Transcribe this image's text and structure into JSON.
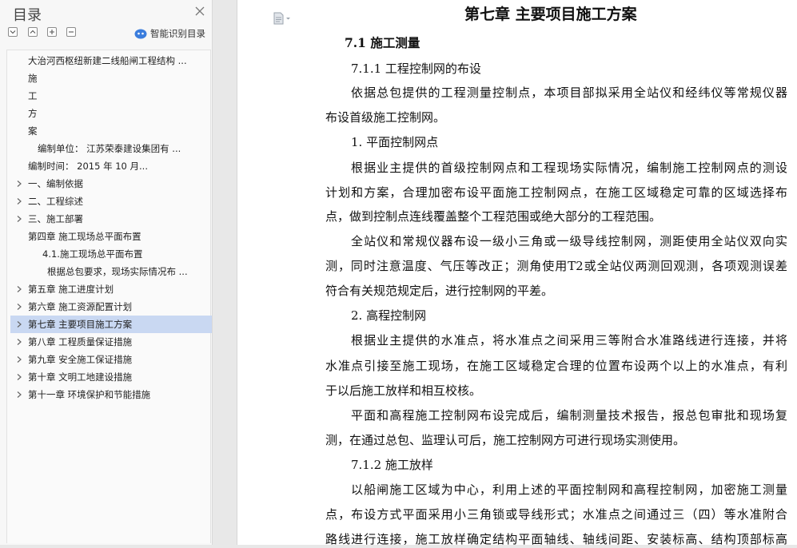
{
  "sidebar": {
    "title": "目录",
    "smart_toc_label": "智能识别目录",
    "items": [
      {
        "label": "大治河西枢纽新建二线船闸工程结构 ...",
        "level": 2,
        "arrow": false,
        "selected": false
      },
      {
        "label": "施",
        "level": 2,
        "arrow": false,
        "selected": false
      },
      {
        "label": "工",
        "level": 2,
        "arrow": false,
        "selected": false
      },
      {
        "label": "方",
        "level": 2,
        "arrow": false,
        "selected": false
      },
      {
        "label": "案",
        "level": 2,
        "arrow": false,
        "selected": false
      },
      {
        "label": "编制单位：    江苏荣泰建设集团有 ...",
        "level": 3,
        "arrow": false,
        "selected": false
      },
      {
        "label": "编制时间：    2015    年    10    月...",
        "level": 2,
        "arrow": false,
        "selected": false
      },
      {
        "label": "一、编制依据",
        "level": 1,
        "arrow": true,
        "selected": false
      },
      {
        "label": "二、工程综述",
        "level": 1,
        "arrow": true,
        "selected": false
      },
      {
        "label": "三、施工部署",
        "level": 1,
        "arrow": true,
        "selected": false
      },
      {
        "label": "第四章  施工现场总平面布置",
        "level": 1,
        "arrow": false,
        "selected": false
      },
      {
        "label": "4.1.施工现场总平面布置",
        "level": 4,
        "arrow": false,
        "selected": false
      },
      {
        "label": "根据总包要求，现场实际情况布 ...",
        "level": 5,
        "arrow": false,
        "selected": false
      },
      {
        "label": "第五章  施工进度计划",
        "level": 1,
        "arrow": true,
        "selected": false
      },
      {
        "label": "第六章  施工资源配置计划",
        "level": 1,
        "arrow": true,
        "selected": false
      },
      {
        "label": "第七章  主要项目施工方案",
        "level": 1,
        "arrow": true,
        "selected": true
      },
      {
        "label": "第八章  工程质量保证措施",
        "level": 1,
        "arrow": true,
        "selected": false
      },
      {
        "label": "第九章    安全施工保证措施",
        "level": 1,
        "arrow": true,
        "selected": false
      },
      {
        "label": "第十章    文明工地建设措施",
        "level": 1,
        "arrow": true,
        "selected": false
      },
      {
        "label": "第十一章  环境保护和节能措施",
        "level": 1,
        "arrow": true,
        "selected": false
      }
    ]
  },
  "document": {
    "chapter_title": "第七章  主要项目施工方案",
    "lines": [
      {
        "text": "7.1 施工测量",
        "kind": "sec",
        "indent": 24,
        "justify": false
      },
      {
        "text": "7.1.1 工程控制网的布设",
        "kind": "normal",
        "indent": 32,
        "justify": false
      },
      {
        "text": "依据总包提供的工程测量控制点，本项目部拟采用全站仪和经纬仪等常规仪器",
        "kind": "normal",
        "indent": 32,
        "justify": true
      },
      {
        "text": "布设首级施工控制网。",
        "kind": "normal",
        "indent": 0,
        "justify": false
      },
      {
        "text": "1. 平面控制网点",
        "kind": "normal",
        "indent": 32,
        "justify": false
      },
      {
        "text": "根据业主提供的首级控制网点和工程现场实际情况，编制施工控制网点的测设",
        "kind": "normal",
        "indent": 32,
        "justify": true
      },
      {
        "text": "计划和方案，合理加密布设平面施工控制网点，在施工区域稳定可靠的区域选择布",
        "kind": "normal",
        "indent": 0,
        "justify": true
      },
      {
        "text": "点，做到控制点连线覆盖整个工程范围或绝大部分的工程范围。",
        "kind": "normal",
        "indent": 0,
        "justify": false
      },
      {
        "text": "全站仪和常规仪器布设一级小三角或一级导线控制网，测距使用全站仪双向实",
        "kind": "normal",
        "indent": 32,
        "justify": true
      },
      {
        "text": "测，同时注意温度、气压等改正；测角使用T2或全站仪两测回观测，各项观测误差",
        "kind": "normal",
        "indent": 0,
        "justify": true
      },
      {
        "text": "符合有关规范规定后，进行控制网的平差。",
        "kind": "normal",
        "indent": 0,
        "justify": false
      },
      {
        "text": "2. 高程控制网",
        "kind": "normal",
        "indent": 32,
        "justify": false
      },
      {
        "text": "根据业主提供的水准点，将水准点之间采用三等附合水准路线进行连接，并将",
        "kind": "normal",
        "indent": 32,
        "justify": true
      },
      {
        "text": "水准点引接至施工现场，在施工区域稳定合理的位置布设两个以上的水准点，有利",
        "kind": "normal",
        "indent": 0,
        "justify": true
      },
      {
        "text": "于以后施工放样和相互校核。",
        "kind": "normal",
        "indent": 0,
        "justify": false
      },
      {
        "text": "平面和高程施工控制网布设完成后，编制测量技术报告，报总包审批和现场复",
        "kind": "normal",
        "indent": 32,
        "justify": true
      },
      {
        "text": "测，在通过总包、监理认可后，施工控制网方可进行现场实测使用。",
        "kind": "normal",
        "indent": 0,
        "justify": false
      },
      {
        "text": "7.1.2  施工放样",
        "kind": "normal",
        "indent": 32,
        "justify": false
      },
      {
        "text": "以船闸施工区域为中心，利用上述的平面控制网和高程控制网，加密施工测量",
        "kind": "normal",
        "indent": 32,
        "justify": true
      },
      {
        "text": "点，布设方式平面采用小三角锁或导线形式；水准点之间通过三（四）等水准附合",
        "kind": "normal",
        "indent": 0,
        "justify": true
      },
      {
        "text": "路线进行连接，施工放样确定结构平面轴线、轴线间距、安装标高、结构顶部标高",
        "kind": "normal",
        "indent": 0,
        "justify": true
      }
    ]
  }
}
